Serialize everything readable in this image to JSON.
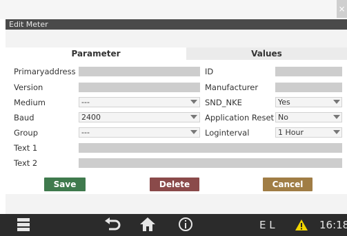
{
  "window": {
    "title": "Edit Meter",
    "close_glyph": "×"
  },
  "tabs": [
    {
      "label": "Parameter"
    },
    {
      "label": "Values"
    }
  ],
  "left": {
    "primaryaddress": {
      "label": "Primaryaddress",
      "value": ""
    },
    "version": {
      "label": "Version",
      "value": ""
    },
    "medium": {
      "label": "Medium",
      "value": "---"
    },
    "baud": {
      "label": "Baud",
      "value": "2400"
    },
    "group": {
      "label": "Group",
      "value": "---"
    },
    "text1": {
      "label": "Text 1",
      "value": ""
    },
    "text2": {
      "label": "Text 2",
      "value": ""
    }
  },
  "right": {
    "id": {
      "label": "ID",
      "value": ""
    },
    "manufacturer": {
      "label": "Manufacturer",
      "value": ""
    },
    "snd_nke": {
      "label": "SND_NKE",
      "value": "Yes"
    },
    "application_reset": {
      "label": "Application Reset",
      "value": "No"
    },
    "loginterval": {
      "label": "Loginterval",
      "value": "1 Hour"
    }
  },
  "buttons": {
    "save": "Save",
    "delete": "Delete",
    "cancel": "Cancel"
  },
  "colors": {
    "save": "#3f7a4d",
    "delete": "#8a4a4a",
    "cancel": "#a07d45"
  },
  "status": {
    "text": "E L",
    "time": "16:18"
  },
  "icons": [
    "menu-icon",
    "back-icon",
    "home-icon",
    "info-icon",
    "warning-icon"
  ]
}
